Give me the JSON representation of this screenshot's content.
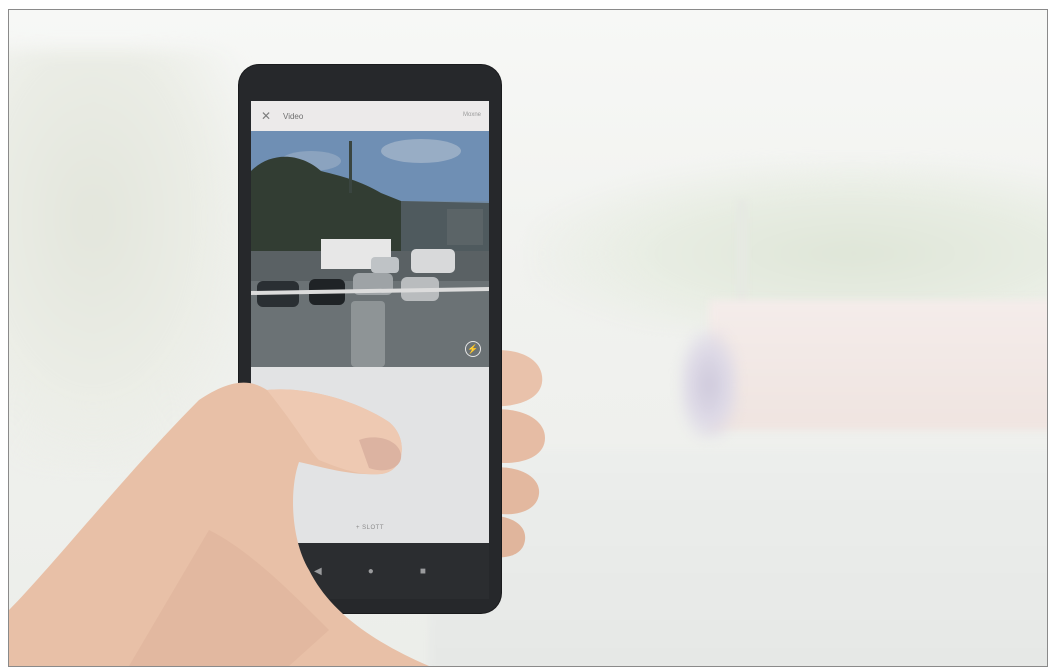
{
  "app_bar": {
    "close_icon": "close-icon",
    "title": "Video",
    "action_label": "Moxne"
  },
  "camera": {
    "flash_icon": "flash-icon"
  },
  "lower_panel": {
    "label": "+ SLOTT"
  },
  "nav_bar": {
    "back_icon": "back-triangle-icon",
    "home_icon": "home-circle-icon",
    "recents_icon": "recents-square-icon"
  }
}
